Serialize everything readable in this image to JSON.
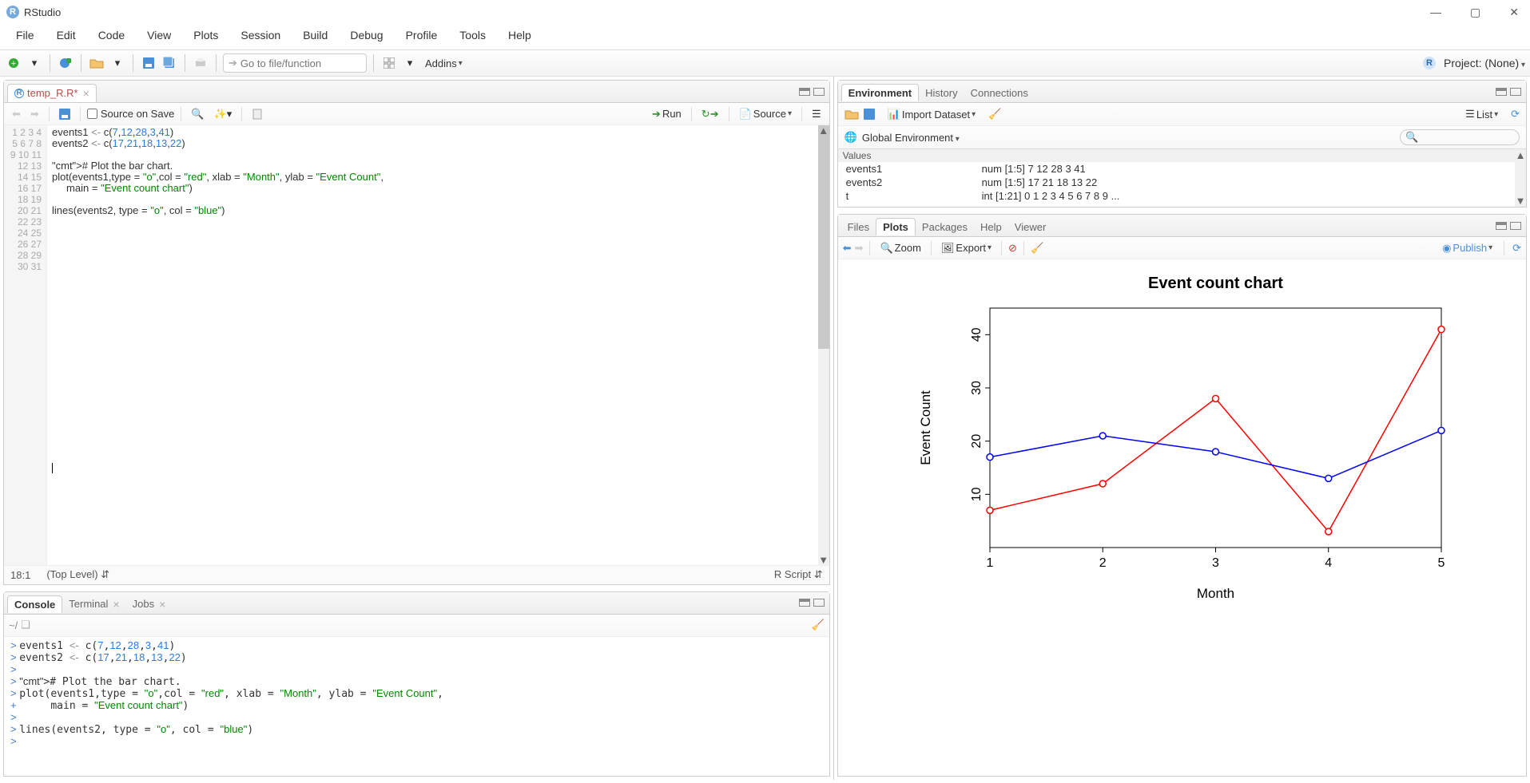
{
  "title": "RStudio",
  "menu": [
    "File",
    "Edit",
    "Code",
    "View",
    "Plots",
    "Session",
    "Build",
    "Debug",
    "Profile",
    "Tools",
    "Help"
  ],
  "toolbar": {
    "goto_placeholder": "Go to file/function",
    "addins": "Addins",
    "project": "Project: (None)"
  },
  "source": {
    "tab_name": "temp_R.R*",
    "source_on_save": "Source on Save",
    "run": "Run",
    "source_btn": "Source",
    "status_left": "18:1",
    "status_mid": "(Top Level)",
    "status_right": "R Script",
    "lines": "events1 <- c(7,12,28,3,41)\nevents2 <- c(17,21,18,13,22)\n\n# Plot the bar chart.\nplot(events1,type = \"o\",col = \"red\", xlab = \"Month\", ylab = \"Event Count\",\n     main = \"Event count chart\")\n\nlines(events2, type = \"o\", col = \"blue\")"
  },
  "console": {
    "tabs": [
      "Console",
      "Terminal",
      "Jobs"
    ],
    "cwd": "~/",
    "body": "> events1 <- c(7,12,28,3,41)\n> events2 <- c(17,21,18,13,22)\n> \n> # Plot the bar chart.\n> plot(events1,type = \"o\",col = \"red\", xlab = \"Month\", ylab = \"Event Count\",\n+      main = \"Event count chart\")\n> \n> lines(events2, type = \"o\", col = \"blue\")\n> "
  },
  "env": {
    "tabs": [
      "Environment",
      "History",
      "Connections"
    ],
    "import": "Import Dataset",
    "list": "List",
    "scope": "Global Environment",
    "values_hdr": "Values",
    "rows": [
      {
        "name": "events1",
        "val": "num [1:5] 7 12 28 3 41"
      },
      {
        "name": "events2",
        "val": "num [1:5] 17 21 18 13 22"
      },
      {
        "name": "t",
        "val": "int [1:21] 0 1 2 3 4 5 6 7 8 9 ..."
      }
    ]
  },
  "plots": {
    "tabs": [
      "Files",
      "Plots",
      "Packages",
      "Help",
      "Viewer"
    ],
    "zoom": "Zoom",
    "export": "Export",
    "publish": "Publish"
  },
  "chart_data": {
    "type": "line",
    "title": "Event count chart",
    "xlabel": "Month",
    "ylabel": "Event Count",
    "x": [
      1,
      2,
      3,
      4,
      5
    ],
    "xticks": [
      1,
      2,
      3,
      4,
      5
    ],
    "yticks": [
      10,
      20,
      30,
      40
    ],
    "ylim": [
      0,
      45
    ],
    "series": [
      {
        "name": "events1",
        "color": "red",
        "values": [
          7,
          12,
          28,
          3,
          41
        ]
      },
      {
        "name": "events2",
        "color": "blue",
        "values": [
          17,
          21,
          18,
          13,
          22
        ]
      }
    ]
  }
}
